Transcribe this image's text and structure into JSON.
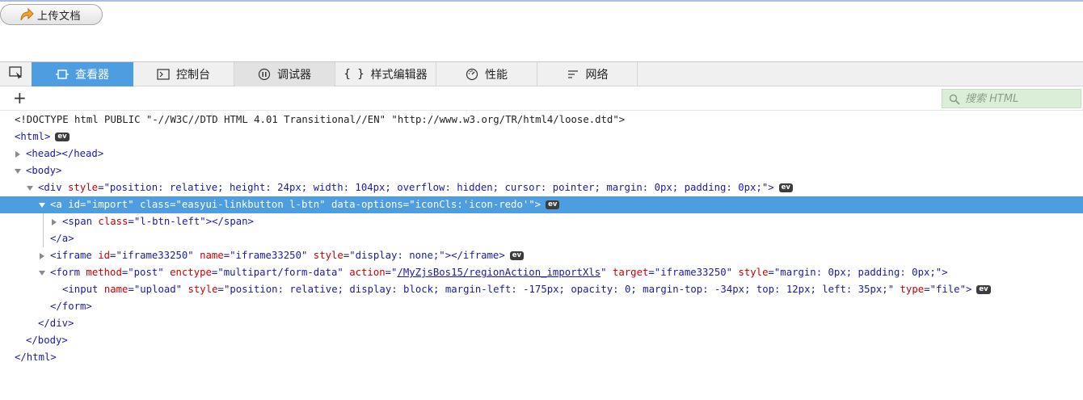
{
  "page": {
    "upload_button_label": "上传文档"
  },
  "devtools": {
    "tabs": [
      {
        "label": "查看器",
        "icon": "inspector-icon"
      },
      {
        "label": "控制台",
        "icon": "console-icon"
      },
      {
        "label": "调试器",
        "icon": "debugger-icon"
      },
      {
        "label": "样式编辑器",
        "icon": "style-editor-icon"
      },
      {
        "label": "性能",
        "icon": "performance-icon"
      },
      {
        "label": "网络",
        "icon": "network-icon"
      }
    ],
    "toolbar": {
      "add_node": "+",
      "search_placeholder": "搜索 HTML"
    },
    "tree": {
      "doctype": "<!DOCTYPE html PUBLIC \"-//W3C//DTD HTML 4.01 Transitional//EN\" \"http://www.w3.org/TR/html4/loose.dtd\">",
      "html_open": "<html>",
      "head": "<head></head>",
      "body_open": "<body>",
      "div_open_pre": "<div ",
      "div_attr_style": "style",
      "div_style_value": "\"position: relative; height: 24px; width: 104px; overflow: hidden; cursor: pointer; margin: 0px; padding: 0px;\"",
      "a_open": "<a id=\"import\" class=\"easyui-linkbutton l-btn\" data-options=\"iconCls:'icon-redo'\">",
      "span_tag": "<span ",
      "span_attr": "class",
      "span_value": "\"l-btn-left\"",
      "span_close": "></span>",
      "a_close": "</a>",
      "iframe_tag": "<iframe ",
      "iframe_id_attr": "id",
      "iframe_id_value": "\"iframe33250\"",
      "iframe_name_attr": "name",
      "iframe_name_value": "\"iframe33250\"",
      "iframe_style_attr": "style",
      "iframe_style_value": "\"display: none;\"",
      "iframe_close": "></iframe>",
      "form_tag": "<form ",
      "form_method_attr": "method",
      "form_method_value": "\"post\"",
      "form_enctype_attr": "enctype",
      "form_enctype_value": "\"multipart/form-data\"",
      "form_action_attr": "action",
      "form_action_value": "/MyZjsBos15/regionAction_importXls",
      "form_target_attr": "target",
      "form_target_value": "\"iframe33250\"",
      "form_style_attr": "style",
      "form_style_value": "\"margin: 0px; padding: 0px;\"",
      "input_tag": "<input ",
      "input_name_attr": "name",
      "input_name_value": "\"upload\"",
      "input_style_attr": "style",
      "input_style_value": "\"position: relative; display: block; margin-left: -175px; opacity: 0; margin-top: -34px; top: 12px; left: 35px;\"",
      "input_type_attr": "type",
      "input_type_value": "\"file\"",
      "form_close": "</form>",
      "div_close": "</div>",
      "body_close": "</body>",
      "html_close": "</html>",
      "event_badge": "ev"
    }
  },
  "colors": {
    "active_tab": "#4d9de0",
    "search_bg": "#dbefd8",
    "tag_color": "#1a1aa6",
    "attr_color": "#c80000"
  }
}
